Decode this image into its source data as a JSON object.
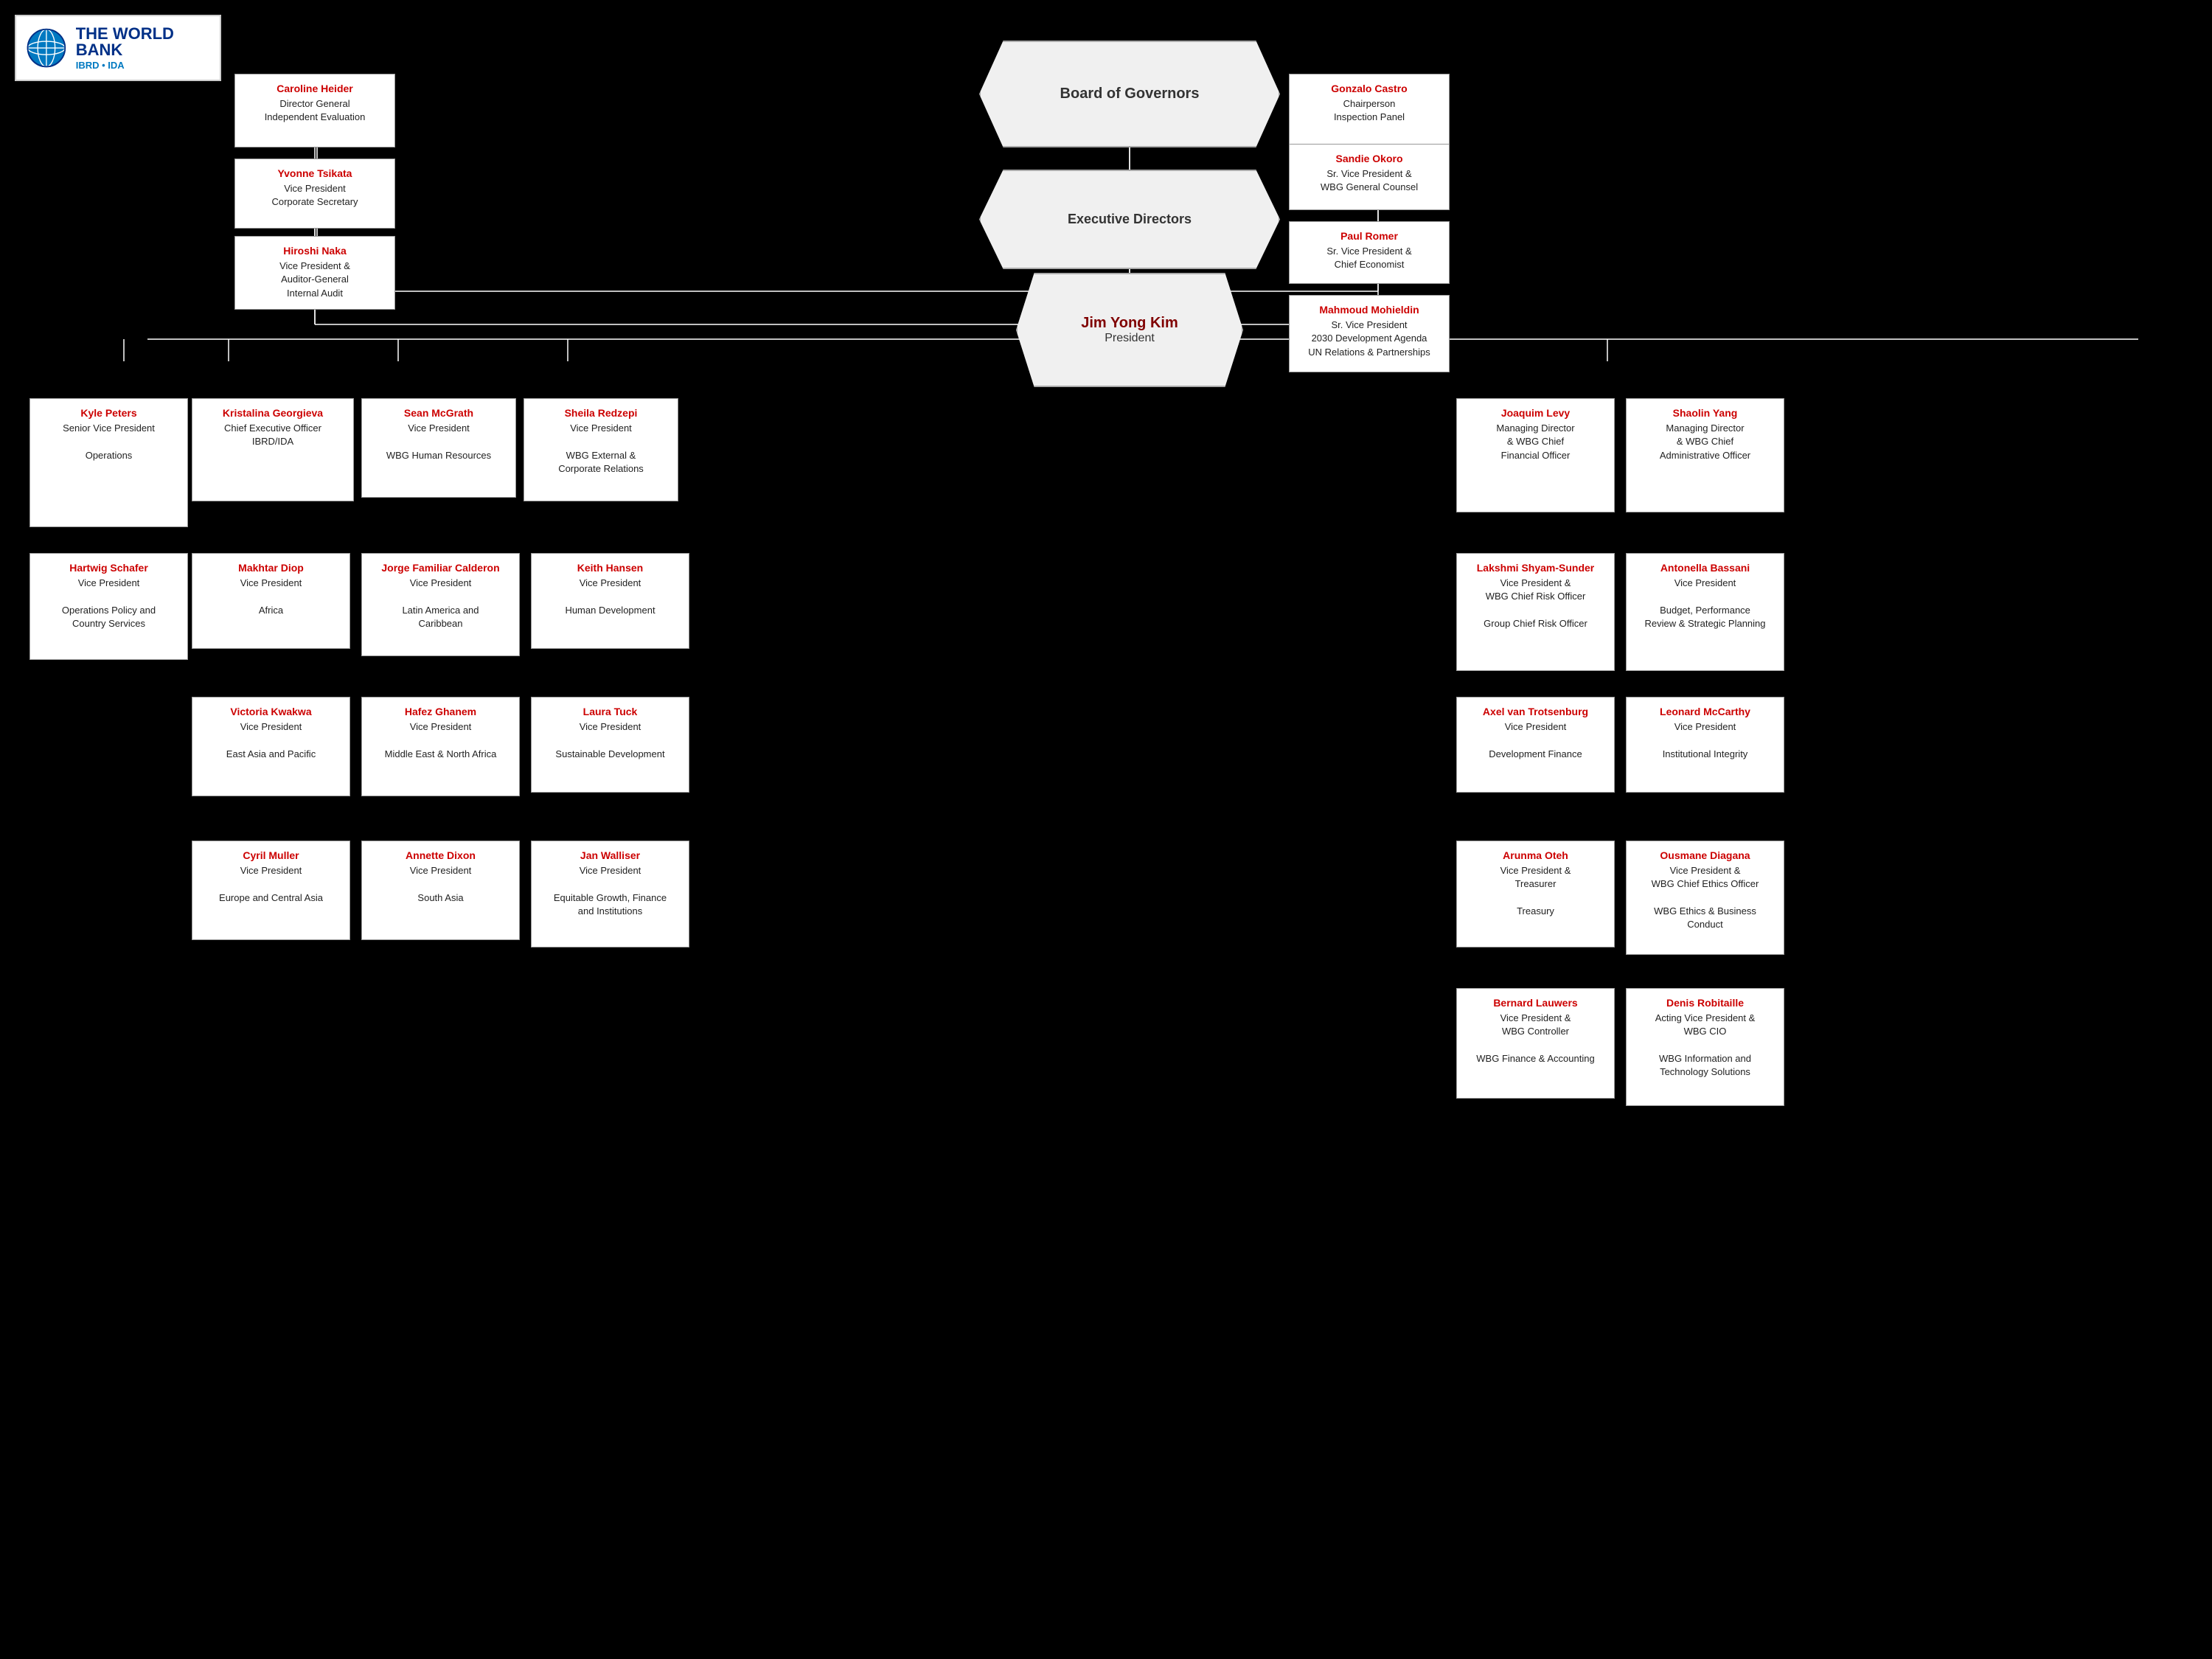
{
  "logo": {
    "title": "THE WORLD BANK",
    "subtitle": "IBRD • IDA"
  },
  "board": {
    "label": "Board of Governors"
  },
  "execDirectors": {
    "label": "Executive Directors"
  },
  "president": {
    "name": "Jim Yong Kim",
    "title": "President"
  },
  "cards": {
    "carolineHeider": {
      "name": "Caroline Heider",
      "title": "Director General\nIndependent Evaluation"
    },
    "gonzaloCastro": {
      "name": "Gonzalo Castro",
      "title": "Chairperson\nInspection Panel"
    },
    "yvonneTsikata": {
      "name": "Yvonne Tsikata",
      "title": "Vice President\nCorporate Secretary"
    },
    "sandieOkoro": {
      "name": "Sandie Okoro",
      "title": "Sr. Vice President &\nWBG General Counsel"
    },
    "paulRomer": {
      "name": "Paul Romer",
      "title": "Sr. Vice President &\nChief Economist"
    },
    "hiroshiNaka": {
      "name": "Hiroshi Naka",
      "title": "Vice President &\nAuditor-General\nInternal Audit"
    },
    "mahmoudMohieldin": {
      "name": "Mahmoud Mohieldin",
      "title": "Sr. Vice President\n2030 Development Agenda\nUN Relations & Partnerships"
    },
    "kylePeters": {
      "name": "Kyle Peters",
      "title": "Senior Vice President\n\nOperations"
    },
    "kristalinaGeorgieva": {
      "name": "Kristalina Georgieva",
      "title": "Chief Executive Officer\nIBRD/IDA"
    },
    "seanMcGrath": {
      "name": "Sean McGrath",
      "title": "Vice President\n\nWBG Human Resources"
    },
    "sheilaRedzepi": {
      "name": "Sheila Redzepi",
      "title": "Vice President\n\nWBG External &\nCorporate Relations"
    },
    "joaquimLevy": {
      "name": "Joaquim Levy",
      "title": "Managing Director\n& WBG Chief\nFinancial Officer"
    },
    "shaolinYang": {
      "name": "Shaolin Yang",
      "title": "Managing Director\n& WBG Chief\nAdministrative Officer"
    },
    "hartwigSchafer": {
      "name": "Hartwig Schafer",
      "title": "Vice President\n\nOperations Policy and\nCountry Services"
    },
    "makhtarDiop": {
      "name": "Makhtar Diop",
      "title": "Vice President\n\nAfrica"
    },
    "jorgeFamiliarCalderon": {
      "name": "Jorge Familiar Calderon",
      "title": "Vice President\n\nLatin America and\nCaribbean"
    },
    "keithHansen": {
      "name": "Keith Hansen",
      "title": "Vice President\n\nHuman Development"
    },
    "lakshmiShyamSunder": {
      "name": "Lakshmi Shyam-Sunder",
      "title": "Vice President &\nWBG Chief Risk Officer\n\nGroup Chief Risk Officer"
    },
    "antonellaBassani": {
      "name": "Antonella Bassani",
      "title": "Vice President\n\nBudget, Performance\nReview & Strategic Planning"
    },
    "victoriaKwakwa": {
      "name": "Victoria Kwakwa",
      "title": "Vice President\n\nEast Asia and Pacific"
    },
    "hafezGhanem": {
      "name": "Hafez Ghanem",
      "title": "Vice President\n\nMiddle East & North Africa"
    },
    "lauraTuck": {
      "name": "Laura Tuck",
      "title": "Vice President\n\nSustainable Development"
    },
    "axelVanTrotsenburg": {
      "name": "Axel van Trotsenburg",
      "title": "Vice President\n\nDevelopment Finance"
    },
    "leonardMcCarthy": {
      "name": "Leonard McCarthy",
      "title": "Vice President\n\nInstitutional Integrity"
    },
    "cyrilMuller": {
      "name": "Cyril Muller",
      "title": "Vice President\n\nEurope and Central Asia"
    },
    "annetteDixon": {
      "name": "Annette Dixon",
      "title": "Vice President\n\nSouth Asia"
    },
    "janWalliser": {
      "name": "Jan Walliser",
      "title": "Vice President\n\nEquitable Growth, Finance\nand Institutions"
    },
    "arunmaOteh": {
      "name": "Arunma Oteh",
      "title": "Vice President &\nTreasurer\n\nTreasury"
    },
    "ousmaneDiagana": {
      "name": "Ousmane Diagana",
      "title": "Vice President &\nWBG Chief Ethics Officer\n\nWBG Ethics & Business\nConduct"
    },
    "bernardLauwers": {
      "name": "Bernard Lauwers",
      "title": "Vice President &\nWBG Controller\n\nWBG Finance & Accounting"
    },
    "denisRobitaille": {
      "name": "Denis Robitaille",
      "title": "Acting Vice President &\nWBG CIO\n\nWBG Information and\nTechnology Solutions"
    }
  }
}
